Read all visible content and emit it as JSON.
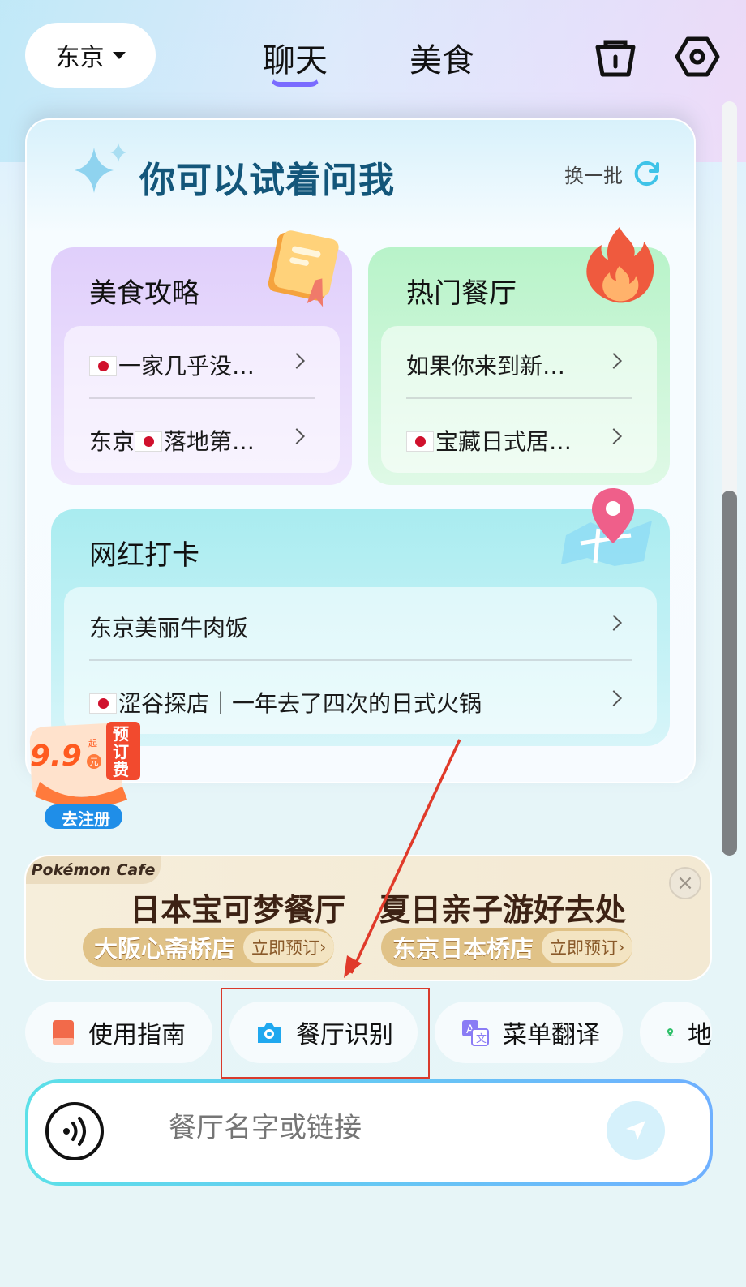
{
  "header": {
    "city_label": "东京",
    "tabs": [
      {
        "label": "聊天",
        "active": true
      },
      {
        "label": "美食",
        "active": false
      }
    ],
    "icons": [
      "shop-bag-icon",
      "settings-hexagon-icon"
    ]
  },
  "suggest": {
    "title": "你可以试着问我",
    "refresh_label": "换一批",
    "food_guide": {
      "title": "美食攻略",
      "items": [
        "一家几乎没…",
        "落地第…"
      ],
      "item2_prefix": "东京"
    },
    "hot_restaurants": {
      "title": "热门餐厅",
      "items": [
        "如果你来到新…",
        "宝藏日式居…"
      ]
    },
    "checkin": {
      "title": "网红打卡",
      "items": [
        "东京美丽牛肉饭",
        "涩谷探店｜一年去了四次的日式火锅"
      ]
    }
  },
  "promo": {
    "price": "9.9",
    "unit_top": "起",
    "unit_bottom": "元",
    "fee_label": "预订费",
    "cta": "去注册"
  },
  "banner": {
    "tag": "Pokémon Cafe",
    "headline_left": "日本宝可梦餐厅",
    "headline_right": "夏日亲子游好去处",
    "stores": [
      {
        "name": "大阪心斋桥店",
        "cta": "立即预订"
      },
      {
        "name": "东京日本桥店",
        "cta": "立即预订"
      }
    ],
    "close_glyph": "×"
  },
  "chips": [
    {
      "label": "使用指南",
      "icon": "guide-book-icon"
    },
    {
      "label": "餐厅识别",
      "icon": "camera-icon"
    },
    {
      "label": "菜单翻译",
      "icon": "translate-icon"
    },
    {
      "label": "地",
      "icon": "map-pin-icon"
    }
  ],
  "input": {
    "placeholder": "餐厅名字或链接"
  },
  "colors": {
    "accent": "#7a6bff",
    "highlight_box": "#d93a2c",
    "title_teal": "#13567a"
  }
}
